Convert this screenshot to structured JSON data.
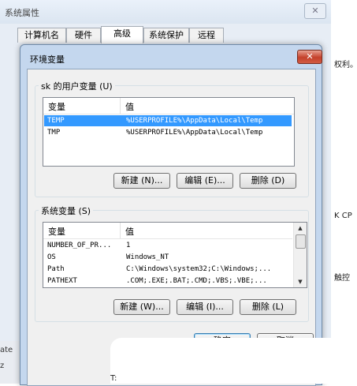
{
  "background": {
    "right_snippets": [
      "权利。",
      "K CP",
      "触控",
      "ate"
    ],
    "bottom_left_text": [
      "ate",
      "z"
    ],
    "bottom_text": "T:"
  },
  "system_properties": {
    "title": "系统属性",
    "tabs": [
      {
        "label": "计算机名"
      },
      {
        "label": "硬件"
      },
      {
        "label": "高级"
      },
      {
        "label": "系统保护"
      },
      {
        "label": "远程"
      }
    ]
  },
  "env_dialog": {
    "title": "环境变量",
    "close_glyph": "✕",
    "user_group_label": "sk 的用户变量 (U)",
    "user_vars": {
      "columns": [
        "变量",
        "值"
      ],
      "rows": [
        {
          "name": "TEMP",
          "value": "%USERPROFILE%\\AppData\\Local\\Temp",
          "selected": true
        },
        {
          "name": "TMP",
          "value": "%USERPROFILE%\\AppData\\Local\\Temp",
          "selected": false
        }
      ]
    },
    "user_buttons": {
      "new": "新建 (N)...",
      "edit": "编辑 (E)...",
      "delete": "删除 (D)"
    },
    "system_group_label": "系统变量 (S)",
    "system_vars": {
      "columns": [
        "变量",
        "值"
      ],
      "rows": [
        {
          "name": "NUMBER_OF_PR...",
          "value": "1"
        },
        {
          "name": "OS",
          "value": "Windows_NT"
        },
        {
          "name": "Path",
          "value": "C:\\Windows\\system32;C:\\Windows;..."
        },
        {
          "name": "PATHEXT",
          "value": ".COM;.EXE;.BAT;.CMD;.VBS;.VBE;..."
        }
      ]
    },
    "system_buttons": {
      "new": "新建 (W)...",
      "edit": "编辑 (I)...",
      "delete": "删除 (L)"
    },
    "ok_label": "确定",
    "cancel_label": "取消"
  },
  "colors": {
    "selection": "#3399ff",
    "title_gradient": "#c4d7ee",
    "close_button": "#c4412b"
  }
}
